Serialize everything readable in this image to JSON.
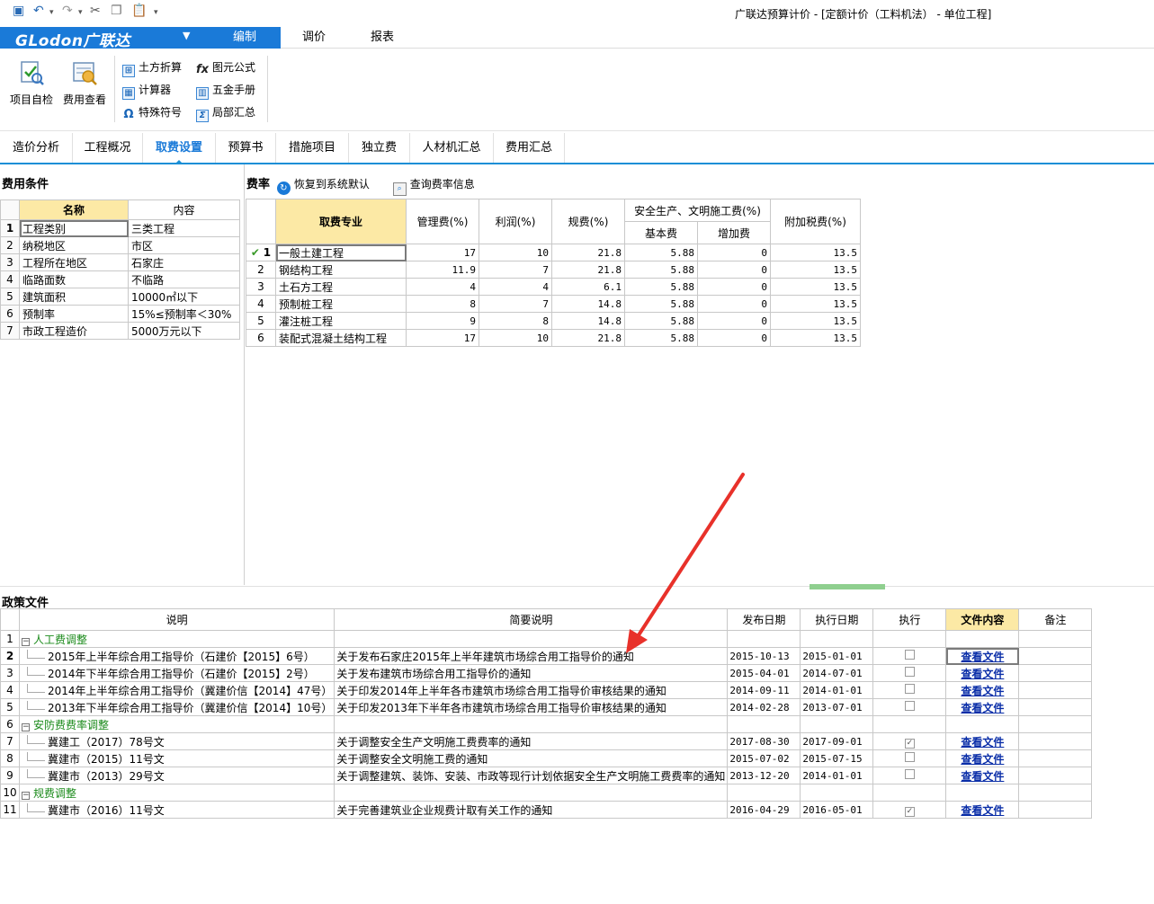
{
  "window": {
    "title": "广联达预算计价 - [定额计价（工料机法） - 单位工程]"
  },
  "quick_access": [
    "save-icon",
    "undo-icon",
    "redo-icon",
    "cut-icon",
    "copy-icon",
    "paste-icon",
    "more-icon"
  ],
  "brand": {
    "logo_text": "GLodon广联达",
    "caret": "▼",
    "color": "#1a7ad8"
  },
  "ribbon_tabs": [
    "编制",
    "调价",
    "报表"
  ],
  "ribbon": {
    "big_buttons": [
      "项目自检",
      "费用查看"
    ],
    "small_buttons": [
      "土方折算",
      "图元公式",
      "计算器",
      "五金手册",
      "特殊符号",
      "局部汇总"
    ]
  },
  "main_tabs": [
    "造价分析",
    "工程概况",
    "取费设置",
    "预算书",
    "措施项目",
    "独立费",
    "人材机汇总",
    "费用汇总"
  ],
  "conditions": {
    "title": "费用条件",
    "headers": [
      "名称",
      "内容"
    ],
    "rows": [
      {
        "no": "1",
        "name": "工程类别",
        "value": "三类工程"
      },
      {
        "no": "2",
        "name": "纳税地区",
        "value": "市区"
      },
      {
        "no": "3",
        "name": "工程所在地区",
        "value": "石家庄"
      },
      {
        "no": "4",
        "name": "临路面数",
        "value": "不临路"
      },
      {
        "no": "5",
        "name": "建筑面积",
        "value": "10000㎡以下"
      },
      {
        "no": "6",
        "name": "预制率",
        "value": "15%≤预制率＜30%"
      },
      {
        "no": "7",
        "name": "市政工程造价",
        "value": "5000万元以下"
      }
    ]
  },
  "rates": {
    "title": "费率",
    "restore_label": "恢复到系统默认",
    "query_label": "查询费率信息",
    "headers": {
      "profession": "取费专业",
      "management": "管理费(%)",
      "profit": "利润(%)",
      "fee": "规费(%)",
      "safety_group": "安全生产、文明施工费(%)",
      "basic": "基本费",
      "extra": "增加费",
      "tax": "附加税费(%)"
    },
    "rows": [
      {
        "no": "1",
        "name": "一般土建工程",
        "management": "17",
        "profit": "10",
        "fee": "21.8",
        "basic": "5.88",
        "extra": "0",
        "tax": "13.5"
      },
      {
        "no": "2",
        "name": "钢结构工程",
        "management": "11.9",
        "profit": "7",
        "fee": "21.8",
        "basic": "5.88",
        "extra": "0",
        "tax": "13.5"
      },
      {
        "no": "3",
        "name": "土石方工程",
        "management": "4",
        "profit": "4",
        "fee": "6.1",
        "basic": "5.88",
        "extra": "0",
        "tax": "13.5"
      },
      {
        "no": "4",
        "name": "预制桩工程",
        "management": "8",
        "profit": "7",
        "fee": "14.8",
        "basic": "5.88",
        "extra": "0",
        "tax": "13.5"
      },
      {
        "no": "5",
        "name": "灌注桩工程",
        "management": "9",
        "profit": "8",
        "fee": "14.8",
        "basic": "5.88",
        "extra": "0",
        "tax": "13.5"
      },
      {
        "no": "6",
        "name": "装配式混凝土结构工程",
        "management": "17",
        "profit": "10",
        "fee": "21.8",
        "basic": "5.88",
        "extra": "0",
        "tax": "13.5"
      }
    ]
  },
  "policy": {
    "title": "政策文件",
    "headers": [
      "说明",
      "简要说明",
      "发布日期",
      "执行日期",
      "执行",
      "文件内容",
      "备注"
    ],
    "view_label": "查看文件",
    "rows": [
      {
        "no": "1",
        "group": true,
        "desc": "人工费调整"
      },
      {
        "no": "2",
        "desc": "2015年上半年综合用工指导价（石建价【2015】6号）",
        "brief": "关于发布石家庄2015年上半年建筑市场综合用工指导价的通知",
        "pub": "2015-10-13",
        "exec": "2015-01-01",
        "checked": false
      },
      {
        "no": "3",
        "desc": "2014年下半年综合用工指导价（石建价【2015】2号）",
        "brief": "关于发布建筑市场综合用工指导价的通知",
        "pub": "2015-04-01",
        "exec": "2014-07-01",
        "checked": false
      },
      {
        "no": "4",
        "desc": "2014年上半年综合用工指导价（冀建价信【2014】47号）",
        "brief": "关于印发2014年上半年各市建筑市场综合用工指导价审核结果的通知",
        "pub": "2014-09-11",
        "exec": "2014-01-01",
        "checked": false
      },
      {
        "no": "5",
        "desc": "2013年下半年综合用工指导价（冀建价信【2014】10号）",
        "brief": "关于印发2013年下半年各市建筑市场综合用工指导价审核结果的通知",
        "pub": "2014-02-28",
        "exec": "2013-07-01",
        "checked": false
      },
      {
        "no": "6",
        "group": true,
        "desc": "安防费费率调整"
      },
      {
        "no": "7",
        "desc": "冀建工（2017）78号文",
        "brief": "关于调整安全生产文明施工费费率的通知",
        "pub": "2017-08-30",
        "exec": "2017-09-01",
        "checked": true
      },
      {
        "no": "8",
        "desc": "冀建市（2015）11号文",
        "brief": "关于调整安全文明施工费的通知",
        "pub": "2015-07-02",
        "exec": "2015-07-15",
        "checked": false
      },
      {
        "no": "9",
        "desc": "冀建市（2013）29号文",
        "brief": "关于调整建筑、装饰、安装、市政等现行计划依据安全生产文明施工费费率的通知",
        "pub": "2013-12-20",
        "exec": "2014-01-01",
        "checked": false
      },
      {
        "no": "10",
        "group": true,
        "desc": "规费调整"
      },
      {
        "no": "11",
        "desc": "冀建市（2016）11号文",
        "brief": "关于完善建筑业企业规费计取有关工作的通知",
        "pub": "2016-04-29",
        "exec": "2016-05-01",
        "checked": true
      }
    ]
  },
  "colors": {
    "accent": "#1a7ad8",
    "header_highlight": "#fce9a5",
    "group_text": "#1a8a1a",
    "link": "#0a2ea8",
    "annotation_arrow": "#e8312a"
  }
}
